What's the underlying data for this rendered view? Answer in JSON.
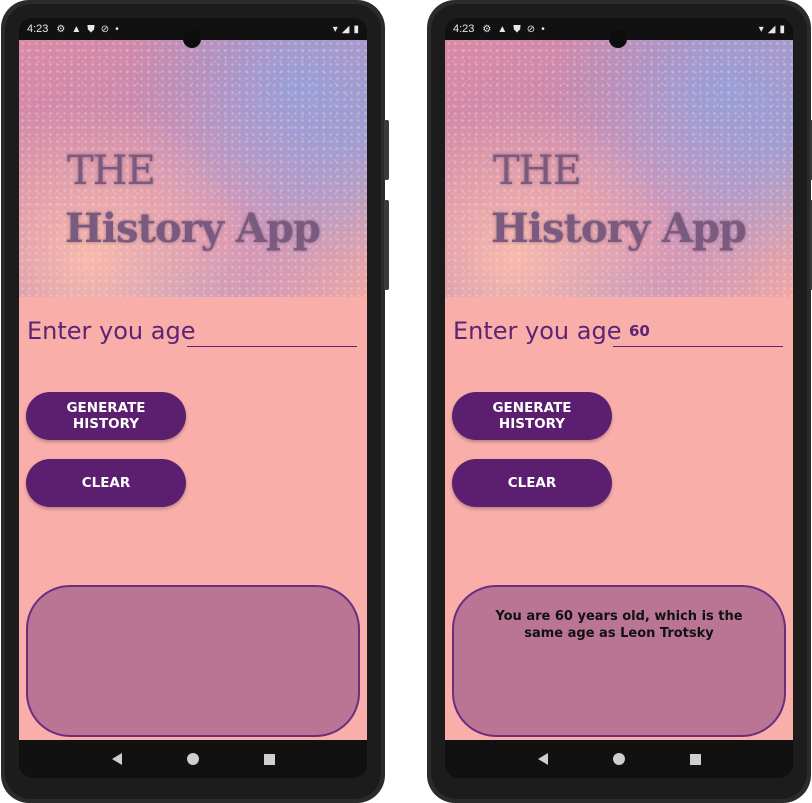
{
  "status": {
    "time": "4:23",
    "icons": [
      "settings-icon",
      "alert-icon",
      "shield-icon",
      "do-not-disturb-icon",
      "dot-icon"
    ],
    "right_icons": [
      "wifi-icon",
      "signal-icon",
      "battery-icon"
    ]
  },
  "app": {
    "hero_title_line1": "THE",
    "hero_title_line2": "History App",
    "age_label": "Enter you age",
    "generate_label": "GENERATE HISTORY",
    "clear_label": "CLEAR"
  },
  "screens": [
    {
      "age_value": "",
      "result_text": ""
    },
    {
      "age_value": "60",
      "result_text": "You are 60 years old, which is the same age as Leon Trotsky"
    }
  ],
  "colors": {
    "app_background": "#f9aeaa",
    "button": "#5c1e6e",
    "result_box": "#b97593",
    "text_accent": "#5e2474"
  }
}
